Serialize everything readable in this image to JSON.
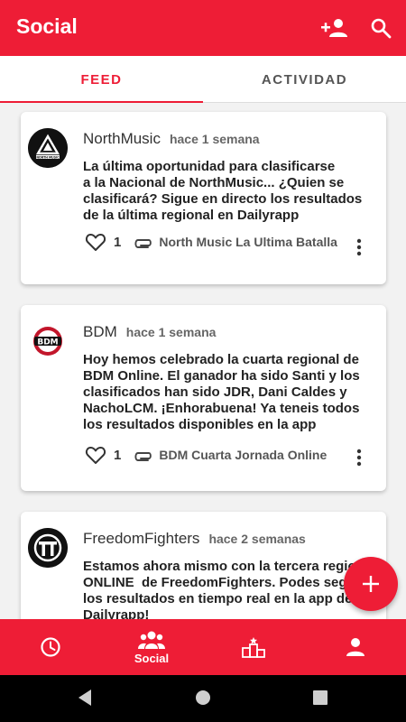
{
  "appbar": {
    "title": "Social",
    "icons": [
      "add-user-icon",
      "search-icon"
    ]
  },
  "tabs": [
    {
      "label": "FEED",
      "active": true
    },
    {
      "label": "ACTIVIDAD",
      "active": false
    }
  ],
  "posts": [
    {
      "author": "NorthMusic",
      "time": "hace 1 semana",
      "text": "La última oportunidad para clasificarse\na la Nacional de NorthMusic... ¿Quien se\nclasificará? Sigue en directo los resultados\nde la última regional en Dailyrapp",
      "likes": "1",
      "attachment": "North Music La Ultima Batalla",
      "avatar_text": "NORTH MUSIC"
    },
    {
      "author": "BDM",
      "time": "hace 1 semana",
      "text": "Hoy hemos celebrado la cuarta regional de\nBDM Online. El ganador ha sido Santi y los\nclasificados han sido JDR, Dani Caldes y\nNachoLCM. ¡Enhorabuena! Ya teneis todos\nlos resultados disponibles en la app",
      "likes": "1",
      "attachment": "BDM Cuarta Jornada Online",
      "avatar_text": "BDM"
    },
    {
      "author": "FreedomFighters",
      "time": "hace 2 semanas",
      "text": "Estamos ahora mismo con la tercera regional\nONLINE  de FreedomFighters. Podes seguir\nlos resultados en tiempo real en la app de\nDailyrapp!"
    }
  ],
  "bottom_nav": [
    {
      "icon": "clock-icon",
      "label": ""
    },
    {
      "icon": "group-icon",
      "label": "Social",
      "active": true
    },
    {
      "icon": "podium-icon",
      "label": ""
    },
    {
      "icon": "person-icon",
      "label": ""
    }
  ],
  "colors": {
    "brand": "#ee1d36",
    "text": "#222222",
    "muted": "#555555"
  }
}
